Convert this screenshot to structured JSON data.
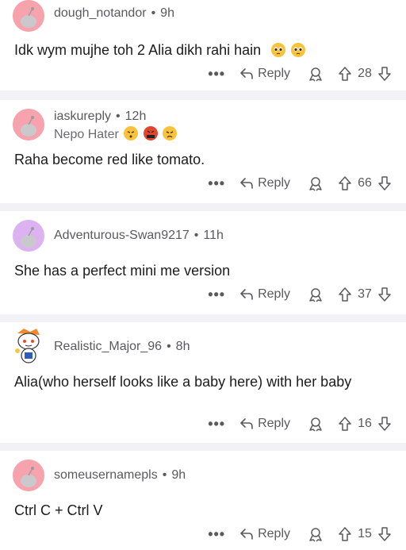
{
  "comments": [
    {
      "username": "dough_notandor",
      "time": "9h",
      "flair": "",
      "text": "Idk wym mujhe toh 2 Alia dikh rahi hain",
      "reply_label": "Reply",
      "score": "28",
      "avatar_color": "#f7a3ad"
    },
    {
      "username": "iaskureply",
      "time": "12h",
      "flair": "Nepo Hater",
      "text": "Raha become red like tomato.",
      "reply_label": "Reply",
      "score": "66",
      "avatar_color": "#f7a3ad"
    },
    {
      "username": "Adventurous-Swan9217",
      "time": "11h",
      "flair": "",
      "text": "She has a perfect mini me version",
      "reply_label": "Reply",
      "score": "37",
      "avatar_color": "#dcb3f0"
    },
    {
      "username": "Realistic_Major_96",
      "time": "8h",
      "flair": "",
      "text": "Alia(who herself looks like a baby here) with her baby",
      "reply_label": "Reply",
      "score": "16",
      "avatar_color": "#ffffff"
    },
    {
      "username": "someusernamepls",
      "time": "9h",
      "flair": "",
      "text": "Ctrl C + Ctrl V",
      "reply_label": "Reply",
      "score": "15",
      "avatar_color": "#f7a3ad"
    }
  ],
  "icons": {
    "more": "more-options-icon",
    "reply": "reply-arrow-icon",
    "award": "award-icon",
    "upvote": "upvote-arrow-icon",
    "downvote": "downvote-arrow-icon"
  },
  "more_glyph": "•••"
}
